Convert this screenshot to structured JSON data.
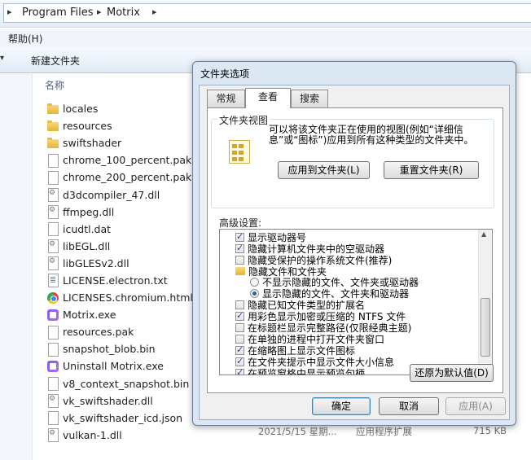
{
  "explorer": {
    "breadcrumb": [
      "Program Files",
      "Motrix"
    ],
    "menu_help": "帮助(H)",
    "toolbar_new_folder": "新建文件夹",
    "column_name": "名称",
    "files": [
      {
        "name": "locales",
        "icon": "folder-icon"
      },
      {
        "name": "resources",
        "icon": "folder-icon"
      },
      {
        "name": "swiftshader",
        "icon": "folder-icon"
      },
      {
        "name": "chrome_100_percent.pak",
        "icon": "file-icon"
      },
      {
        "name": "chrome_200_percent.pak",
        "icon": "file-icon"
      },
      {
        "name": "d3dcompiler_47.dll",
        "icon": "dll-icon"
      },
      {
        "name": "ffmpeg.dll",
        "icon": "dll-icon"
      },
      {
        "name": "icudtl.dat",
        "icon": "file-icon"
      },
      {
        "name": "libEGL.dll",
        "icon": "dll-icon"
      },
      {
        "name": "libGLESv2.dll",
        "icon": "dll-icon"
      },
      {
        "name": "LICENSE.electron.txt",
        "icon": "text-file-icon"
      },
      {
        "name": "LICENSES.chromium.html",
        "icon": "chrome-html-icon"
      },
      {
        "name": "Motrix.exe",
        "icon": "app-icon"
      },
      {
        "name": "resources.pak",
        "icon": "file-icon"
      },
      {
        "name": "snapshot_blob.bin",
        "icon": "file-icon"
      },
      {
        "name": "Uninstall Motrix.exe",
        "icon": "app-icon"
      },
      {
        "name": "v8_context_snapshot.bin",
        "icon": "file-icon"
      },
      {
        "name": "vk_swiftshader.dll",
        "icon": "dll-icon"
      },
      {
        "name": "vk_swiftshader_icd.json",
        "icon": "file-icon"
      },
      {
        "name": "vulkan-1.dll",
        "icon": "dll-icon"
      }
    ],
    "last_row_details": {
      "date": "2021/5/15 星期...",
      "type": "应用程序扩展",
      "size": "715 KB"
    }
  },
  "dialog": {
    "title": "文件夹选项",
    "tabs": [
      "常规",
      "查看",
      "搜索"
    ],
    "active_tab": "查看",
    "folder_view": {
      "group_title": "文件夹视图",
      "description": "可以将该文件夹正在使用的视图(例如“详细信息”或“图标”)应用到所有这种类型的文件夹中。",
      "apply_button": "应用到文件夹(L)",
      "reset_button": "重置文件夹(R)"
    },
    "advanced_label": "高级设置:",
    "advanced_items": [
      {
        "kind": "checkbox",
        "checked": true,
        "label": "显示驱动器号"
      },
      {
        "kind": "checkbox",
        "checked": true,
        "label": "隐藏计算机文件夹中的空驱动器"
      },
      {
        "kind": "checkbox",
        "checked": false,
        "label": "隐藏受保护的操作系统文件(推荐)"
      },
      {
        "kind": "folder",
        "checked": false,
        "label": "隐藏文件和文件夹"
      },
      {
        "kind": "radio",
        "checked": false,
        "label": "不显示隐藏的文件、文件夹或驱动器"
      },
      {
        "kind": "radio",
        "checked": true,
        "label": "显示隐藏的文件、文件夹和驱动器"
      },
      {
        "kind": "checkbox",
        "checked": false,
        "label": "隐藏已知文件类型的扩展名"
      },
      {
        "kind": "checkbox",
        "checked": true,
        "label": "用彩色显示加密或压缩的 NTFS 文件"
      },
      {
        "kind": "checkbox",
        "checked": false,
        "label": "在标题栏显示完整路径(仅限经典主题)"
      },
      {
        "kind": "checkbox",
        "checked": false,
        "label": "在单独的进程中打开文件夹窗口"
      },
      {
        "kind": "checkbox",
        "checked": true,
        "label": "在缩略图上显示文件图标"
      },
      {
        "kind": "checkbox",
        "checked": true,
        "label": "在文件夹提示中显示文件大小信息"
      },
      {
        "kind": "checkbox",
        "checked": true,
        "label": "在预览窗格中显示预览句柄"
      }
    ],
    "restore_defaults_button": "还原为默认值(D)",
    "ok_button": "确定",
    "cancel_button": "取消",
    "apply_button": "应用(A)"
  }
}
